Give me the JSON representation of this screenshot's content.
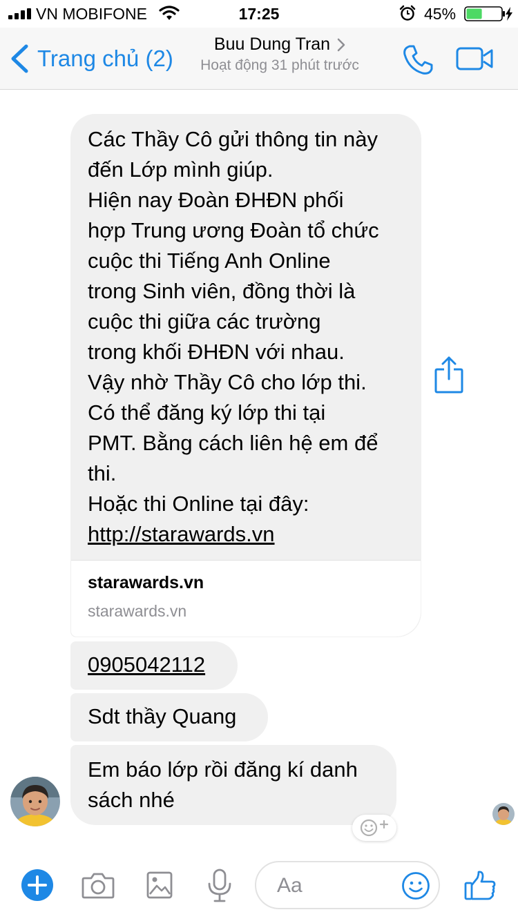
{
  "status_bar": {
    "carrier": "VN MOBIFONE",
    "time": "17:25",
    "battery_percent": "45%",
    "battery_level": 0.45,
    "icons": [
      "signal-icon",
      "wifi-icon",
      "alarm-icon",
      "battery-icon",
      "charging-icon"
    ]
  },
  "nav": {
    "back_label": "Trang chủ (2)",
    "contact_name": "Buu Dung Tran",
    "contact_status": "Hoạt động 31 phút trước",
    "icons": [
      "back-chevron-icon",
      "chevron-right-icon",
      "phone-icon",
      "video-camera-icon"
    ]
  },
  "messages": {
    "main_lines": [
      "Các Thầy Cô gửi thông tin này",
      "đến Lớp mình giúp.",
      "Hiện nay Đoàn ĐHĐN phối",
      "hợp Trung ương Đoàn tổ chức",
      "cuộc thi Tiếng Anh Online",
      "trong Sinh viên, đồng thời là",
      "cuộc thi giữa các trường",
      "trong khối ĐHĐN với nhau.",
      "Vậy nhờ Thầy Cô cho lớp thi.",
      "Có thể đăng ký lớp thi tại",
      "PMT. Bằng cách liên hệ em để",
      "thi.",
      "Hoặc thi Online tại đây:"
    ],
    "main_link": "http://starawards.vn",
    "link_preview": {
      "title": "starawards.vn",
      "domain": "starawards.vn"
    },
    "phone": "0905042112",
    "sdt": "Sdt thầy Quang",
    "last": "Em báo lớp rồi đăng kí danh sách nhé"
  },
  "composer": {
    "placeholder": "Aa",
    "icons": [
      "plus-icon",
      "camera-icon",
      "gallery-icon",
      "microphone-icon",
      "emoji-icon",
      "thumbs-up-icon"
    ]
  },
  "colors": {
    "accent": "#1e88e5",
    "bubble": "#f0f0f0",
    "battery_fill": "#4cd964",
    "secondary_text": "#8e8e93"
  }
}
